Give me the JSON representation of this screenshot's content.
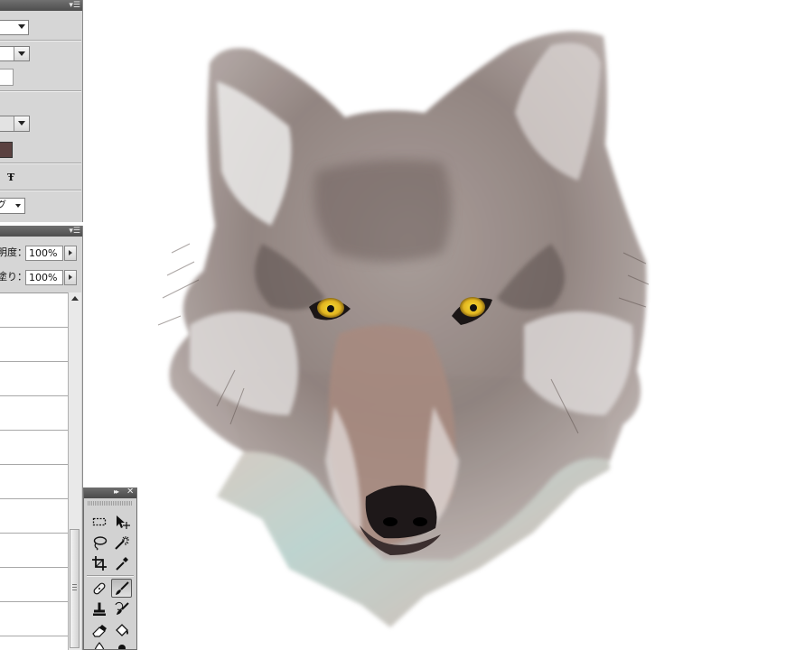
{
  "layers_panel": {
    "opacity_label": "明度：",
    "opacity_value": "100%",
    "fill_label": "塗り：",
    "fill_value": "100%"
  },
  "character_panel": {
    "language_value": "グ"
  },
  "colors": {
    "panel_bg": "#d6d6d6",
    "panel_header": "#4e4e4e",
    "color_swatch": "#5a4140",
    "canvas_bg": "#ffffff"
  },
  "tools": [
    {
      "name": "marquee",
      "icon": "marquee-icon"
    },
    {
      "name": "move",
      "icon": "move-icon"
    },
    {
      "name": "lasso",
      "icon": "lasso-icon"
    },
    {
      "name": "magic-wand",
      "icon": "magic-wand-icon"
    },
    {
      "name": "crop",
      "icon": "crop-icon"
    },
    {
      "name": "eyedropper",
      "icon": "eyedropper-icon"
    },
    {
      "name": "healing-brush",
      "icon": "healing-brush-icon"
    },
    {
      "name": "brush",
      "icon": "brush-icon",
      "active": true
    },
    {
      "name": "clone-stamp",
      "icon": "clone-stamp-icon"
    },
    {
      "name": "history-brush",
      "icon": "history-brush-icon"
    },
    {
      "name": "eraser",
      "icon": "eraser-icon"
    },
    {
      "name": "paint-bucket",
      "icon": "paint-bucket-icon"
    },
    {
      "name": "blur",
      "icon": "blur-icon"
    },
    {
      "name": "dodge",
      "icon": "dodge-icon"
    }
  ],
  "canvas": {
    "subject": "wolf-painting"
  }
}
